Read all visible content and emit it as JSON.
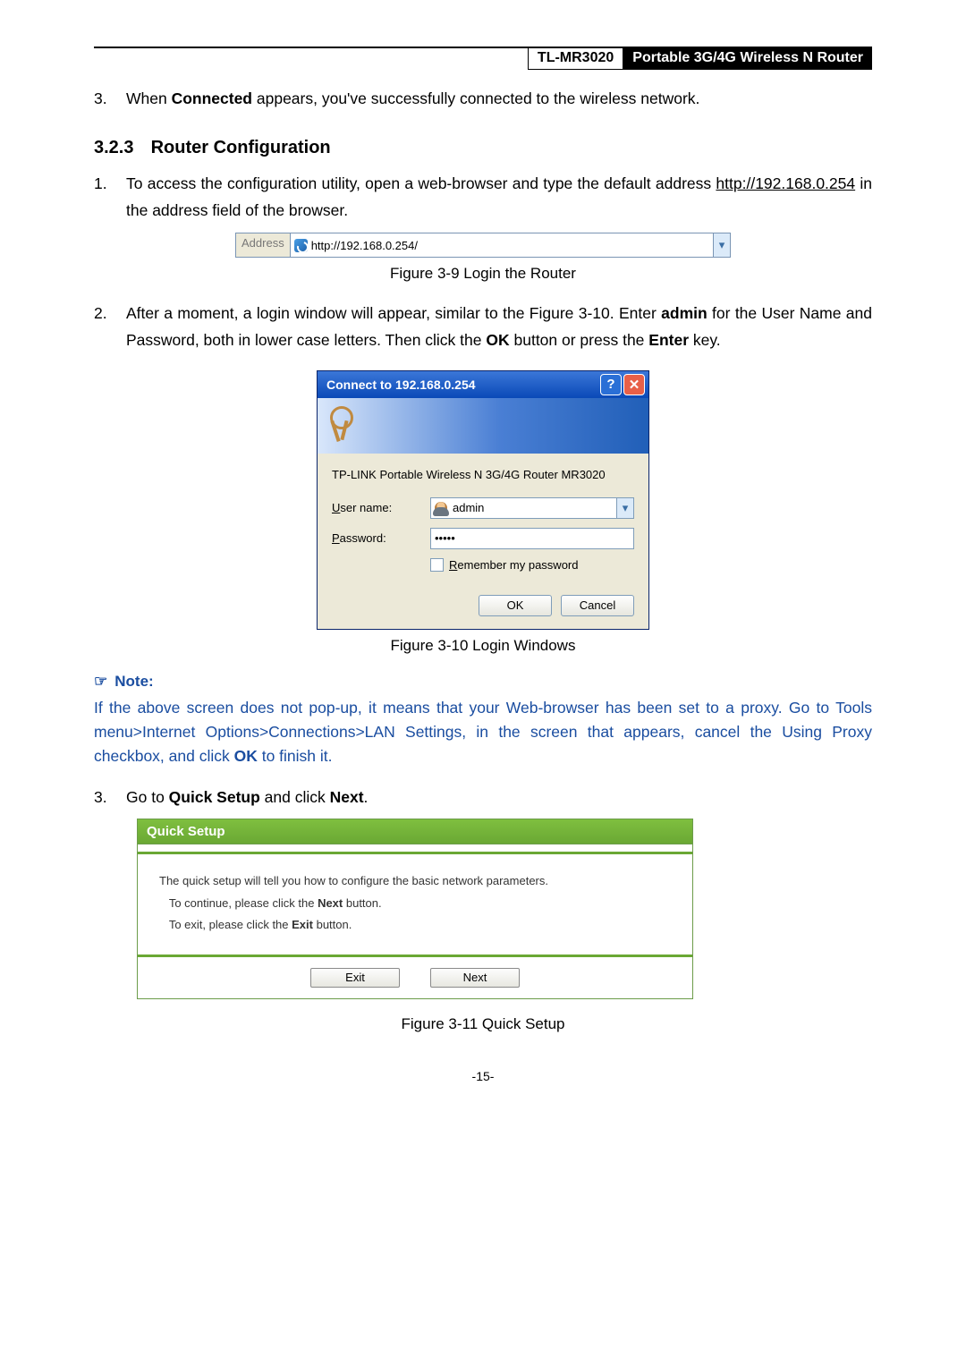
{
  "header": {
    "model": "TL-MR3020",
    "title": "Portable 3G/4G Wireless N Router"
  },
  "item3": {
    "num": "3.",
    "before": "When ",
    "bold": "Connected",
    "after": " appears, you've successfully connected to the wireless network."
  },
  "section": {
    "num": "3.2.3",
    "title": "Router Configuration"
  },
  "step1": {
    "num": "1.",
    "line1": "To access the configuration utility, open a web-browser and type the default address ",
    "url": "http://192.168.0.254",
    "line1_after": " in the address field of the browser."
  },
  "addressbar": {
    "label": "Address",
    "url": "http://192.168.0.254/"
  },
  "fig9": "Figure 3-9    Login the Router",
  "step2": {
    "num": "2.",
    "p1_a": "After a moment, a login window will appear, similar to the Figure 3-10. Enter ",
    "p1_b": "admin",
    "p1_c": " for the User Name and Password, both in lower case letters. Then click the ",
    "p1_d": "OK",
    "p1_e": " button or press the ",
    "p1_f": "Enter",
    "p1_g": " key."
  },
  "login": {
    "title": "Connect to 192.168.0.254",
    "desc": "TP-LINK Portable Wireless N 3G/4G Router MR3020",
    "user_label_u": "U",
    "user_label_rest": "ser name:",
    "user_value": "admin",
    "pass_label_u": "P",
    "pass_label_rest": "assword:",
    "pass_value": "•••••",
    "remember_u": "R",
    "remember_rest": "emember my password",
    "ok": "OK",
    "cancel": "Cancel"
  },
  "fig10": "Figure 3-10    Login Windows",
  "note": {
    "label": "Note:",
    "body_a": "If the above screen does not pop-up, it means that your Web-browser has been set to a proxy. Go to Tools menu>Internet Options>Connections>LAN Settings, in the screen that appears, cancel the Using Proxy checkbox, and click ",
    "body_b": "OK",
    "body_c": " to finish it."
  },
  "step3": {
    "num": "3.",
    "a": "Go to ",
    "b": "Quick Setup",
    "c": " and click ",
    "d": "Next",
    "e": "."
  },
  "qs": {
    "head": "Quick Setup",
    "l1": "The quick setup will tell you how to configure the basic network parameters.",
    "l2_a": "To continue, please click the ",
    "l2_b": "Next",
    "l2_c": " button.",
    "l3_a": "To exit, please click the ",
    "l3_b": "Exit",
    "l3_c": "  button.",
    "exit": "Exit",
    "next": "Next"
  },
  "fig11": "Figure 3-11    Quick Setup",
  "page_number": "-15-"
}
